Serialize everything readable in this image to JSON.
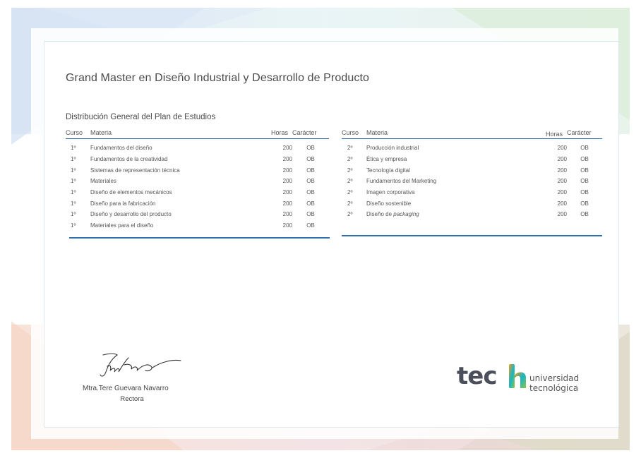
{
  "title": "Grand Master en Diseño Industrial y Desarrollo de Producto",
  "subtitle": "Distribución General del Plan de Estudios",
  "table_headers": {
    "curso": "Curso",
    "materia": "Materia",
    "horas": "Horas",
    "caracter": "Carácter"
  },
  "left_rows": [
    {
      "curso": "1º",
      "materia": "Fundamentos del diseño",
      "horas": "200",
      "caracter": "OB"
    },
    {
      "curso": "1º",
      "materia": "Fundamentos de la creatividad",
      "horas": "200",
      "caracter": "OB"
    },
    {
      "curso": "1º",
      "materia": "Sistemas de representación técnica",
      "horas": "200",
      "caracter": "OB"
    },
    {
      "curso": "1º",
      "materia": "Materiales",
      "horas": "200",
      "caracter": "OB"
    },
    {
      "curso": "1º",
      "materia": "Diseño de elementos mecánicos",
      "horas": "200",
      "caracter": "OB"
    },
    {
      "curso": "1º",
      "materia": "Diseño para la fabricación",
      "horas": "200",
      "caracter": "OB"
    },
    {
      "curso": "1º",
      "materia": "Diseño y desarrollo del producto",
      "horas": "200",
      "caracter": "OB"
    },
    {
      "curso": "1º",
      "materia": "Materiales para el diseño",
      "horas": "200",
      "caracter": "OB"
    }
  ],
  "right_rows": [
    {
      "curso": "2º",
      "materia": "Producción industrial",
      "horas": "200",
      "caracter": "OB"
    },
    {
      "curso": "2º",
      "materia": "Ética y empresa",
      "horas": "200",
      "caracter": "OB"
    },
    {
      "curso": "2º",
      "materia": "Tecnología digital",
      "horas": "200",
      "caracter": "OB"
    },
    {
      "curso": "2º",
      "materia": "Fundamentos del Marketing",
      "horas": "200",
      "caracter": "OB"
    },
    {
      "curso": "2º",
      "materia": "Imagen corporativa",
      "horas": "200",
      "caracter": "OB"
    },
    {
      "curso": "2º",
      "materia": "Diseño sostenible",
      "horas": "200",
      "caracter": "OB"
    },
    {
      "curso": "2º",
      "materia_prefix": "Diseño de ",
      "materia_italic": "packaging",
      "horas": "200",
      "caracter": "OB"
    }
  ],
  "signer": {
    "name": "Mtra.Tere Guevara Navarro",
    "role": "Rectora"
  },
  "logo": {
    "word": "tec",
    "line1": "universidad",
    "line2": "tecnológica"
  },
  "colors": {
    "accent": "#2f6fb0",
    "logo_gray": "#4a4f5a",
    "logo_gradient": [
      "#f39c12",
      "#16b6c8",
      "#8cc63f"
    ]
  }
}
